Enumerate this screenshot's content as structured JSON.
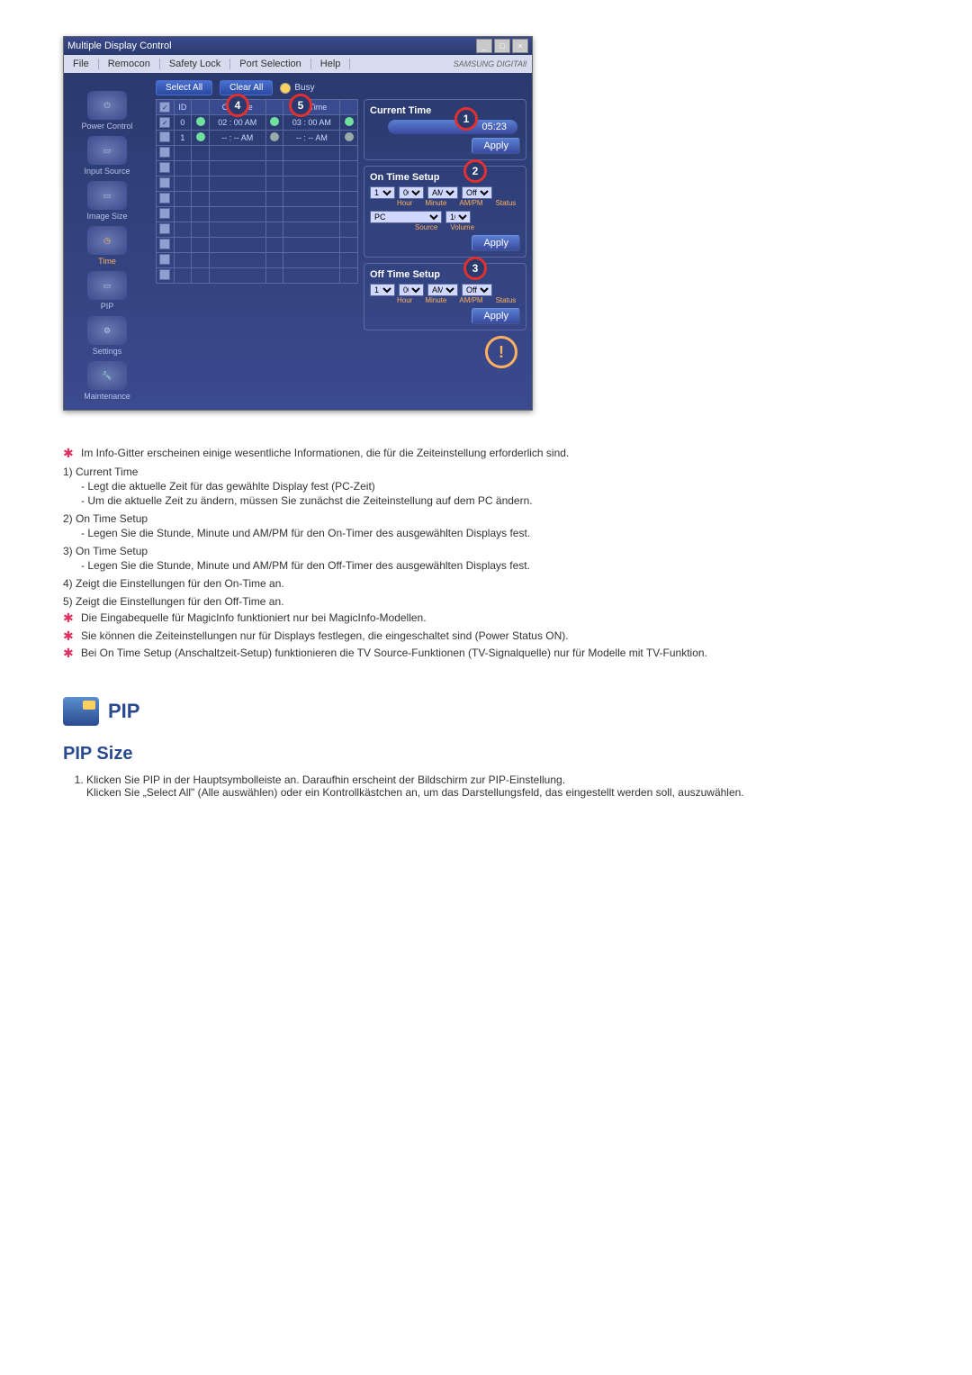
{
  "window": {
    "title": "Multiple Display Control",
    "brand": "SAMSUNG DIGITAll"
  },
  "menu": [
    "File",
    "Remocon",
    "Safety Lock",
    "Port Selection",
    "Help"
  ],
  "sidebar": [
    {
      "label": "Power Control"
    },
    {
      "label": "Input Source"
    },
    {
      "label": "Image Size"
    },
    {
      "label": "Time",
      "active": true
    },
    {
      "label": "PIP"
    },
    {
      "label": "Settings"
    },
    {
      "label": "Maintenance"
    }
  ],
  "toolbar": {
    "select_all": "Select All",
    "clear_all": "Clear All",
    "busy": "Busy"
  },
  "grid": {
    "headers": [
      "",
      "ID",
      "",
      "On Time",
      "",
      "Off Time",
      ""
    ],
    "rows": [
      {
        "chk": true,
        "id": "0",
        "g": true,
        "on": "02 : 00 AM",
        "g2": true,
        "off": "03 : 00 AM",
        "g3": true
      },
      {
        "chk": false,
        "id": "1",
        "g": true,
        "on": "-- : -- AM",
        "g2": false,
        "off": "-- : -- AM",
        "g3": false
      }
    ],
    "blank_rows": 9
  },
  "annotations": {
    "a1": "1",
    "a2": "2",
    "a3": "3",
    "a4": "4",
    "a5": "5"
  },
  "right_panel": {
    "current_time_title": "Current Time",
    "current_time_value": "05:23",
    "apply": "Apply",
    "on_time_title": "On Time Setup",
    "off_time_title": "Off Time Setup",
    "hour_opt": "1",
    "min_opt": "00",
    "ampm_opt": "AM",
    "status_opt": "Off",
    "source_opt": "PC",
    "volume_opt": "10",
    "labels": {
      "hour": "Hour",
      "minute": "Minute",
      "ampm": "AM/PM",
      "status": "Status",
      "source": "Source",
      "volume": "Volume"
    }
  },
  "doc": {
    "intro": "Im Info-Gitter erscheinen einige wesentliche Informationen, die für die Zeiteinstellung erforderlich sind.",
    "items": [
      {
        "num": "1)",
        "title": "Current Time",
        "subs": [
          "- Legt die aktuelle Zeit für das gewählte Display fest (PC-Zeit)",
          "- Um die aktuelle Zeit zu ändern, müssen Sie zunächst die Zeiteinstellung auf dem PC ändern."
        ]
      },
      {
        "num": "2)",
        "title": "On Time Setup",
        "subs": [
          "- Legen Sie die Stunde, Minute und AM/PM für den On-Timer des ausgewählten Displays fest."
        ]
      },
      {
        "num": "3)",
        "title": "On Time Setup",
        "subs": [
          "- Legen Sie die Stunde, Minute und AM/PM für den Off-Timer des ausgewählten Displays fest."
        ]
      },
      {
        "num": "4)",
        "title": "Zeigt die Einstellungen für den On-Time an.",
        "subs": []
      },
      {
        "num": "5)",
        "title": "Zeigt die Einstellungen für den Off-Time an.",
        "subs": []
      }
    ],
    "notes": [
      "Die Eingabequelle für MagicInfo funktioniert nur bei MagicInfo-Modellen.",
      "Sie können die Zeiteinstellungen nur für Displays festlegen, die eingeschaltet sind (Power Status ON).",
      "Bei On Time Setup (Anschaltzeit-Setup) funktionieren die TV Source-Funktionen (TV-Signalquelle) nur für Modelle mit TV-Funktion."
    ],
    "pip_heading": "PIP",
    "pip_section": "PIP Size",
    "pip_steps": [
      "Klicken Sie PIP in der Hauptsymbolleiste an. Daraufhin erscheint der Bildschirm zur PIP-Einstellung.\nKlicken Sie „Select All\" (Alle auswählen) oder ein Kontrollkästchen an, um das Darstellungsfeld, das eingestellt werden soll, auszuwählen."
    ]
  }
}
